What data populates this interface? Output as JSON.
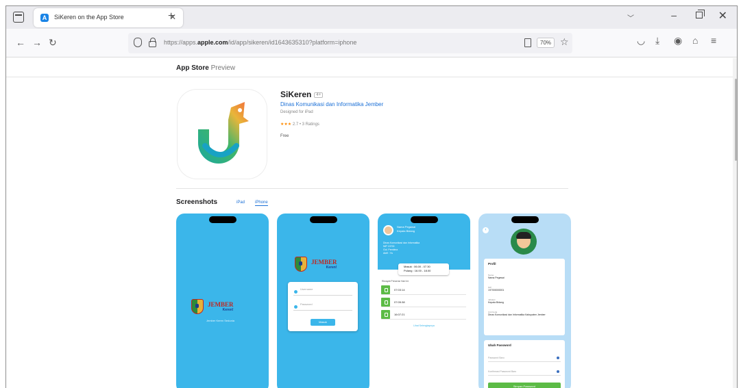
{
  "browser": {
    "tab_title": "SiKeren on the App Store",
    "tab_favicon": "A",
    "url_prefix": "https://apps.",
    "url_domain": "apple.com",
    "url_path": "/id/app/sikeren/id1643635310?platform=iphone",
    "zoom": "70%",
    "icons": [
      "tab-overview-icon",
      "close-icon",
      "new-tab-icon",
      "chevron-down-icon",
      "minimize-icon",
      "restore-icon",
      "window-close-icon",
      "back-icon",
      "forward-icon",
      "reload-icon",
      "shield-icon",
      "lock-icon",
      "reader-view-icon",
      "bookmark-star-icon",
      "pocket-icon",
      "download-icon",
      "account-icon",
      "extensions-icon",
      "menu-icon"
    ]
  },
  "store": {
    "title": "App Store",
    "preview": "Preview"
  },
  "app": {
    "name": "SiKeren",
    "age_badge": "4+",
    "developer": "Dinas Komunikasi dan Informatika Jember",
    "designed_for": "Designed for iPad",
    "stars": "★★★",
    "rating_text": "2.7 • 3 Ratings",
    "price": "Free"
  },
  "screenshots": {
    "title": "Screenshots",
    "tabs": [
      "iPad",
      "iPhone"
    ],
    "active_tab": "iPhone",
    "jember_brand": "JEMBER",
    "jember_sub": "Keren!",
    "tagline": "Jember Keren Sedunia",
    "login_user_placeholder": "Username",
    "login_pass_placeholder": "Password",
    "login_button": "Masuk",
    "s3_name": "Nama Pegawai",
    "s3_role": "Kepala Bidang",
    "s3_info": [
      "Dinas Komunikasi dan Informatika",
      "NIP 19700",
      "Gol. Pembina",
      "Aktif : Ya"
    ],
    "s3_sched_1": "Masuk : 06.00 - 07.30",
    "s3_sched_2": "Pulang : 16.00 - 18.00",
    "s3_label": "Riwayat Presensi Hari Ini",
    "s3_times": [
      "07:03:14",
      "07:05:38",
      "16:07:21"
    ],
    "s3_link": "Lihat Selengkapnya",
    "s4_profile": "Profil",
    "s4_fields": [
      {
        "label": "Nama",
        "value": "Nama Pegawai"
      },
      {
        "label": "NIP",
        "value": "197000000001"
      },
      {
        "label": "Jabatan",
        "value": "Kepala Bidang"
      },
      {
        "label": "Unit Kerja",
        "value": "Dinas Komunikasi dan Informatika Kabupaten Jember"
      }
    ],
    "s4_password_title": "Ubah Password",
    "s4_pass_old": "Password Baru",
    "s4_pass_new": "Konfirmasi Password Baru",
    "s4_button": "Simpan Password"
  }
}
